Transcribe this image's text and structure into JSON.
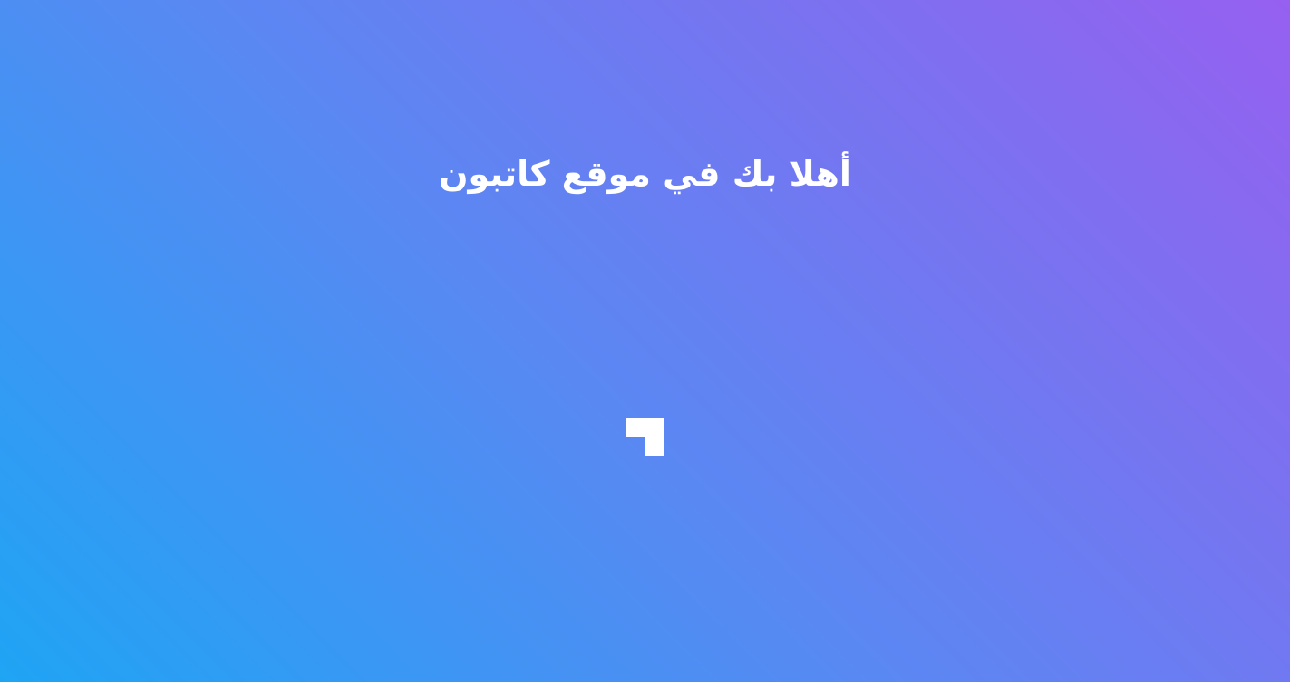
{
  "page": {
    "welcome_title": "أهلا بك في موقع كاتبون"
  },
  "loader": {
    "icon": "loading-spinner-icon",
    "color": "#ffffff"
  },
  "theme": {
    "gradient_start": "#1fa4f4",
    "gradient_end": "#9660f0"
  }
}
